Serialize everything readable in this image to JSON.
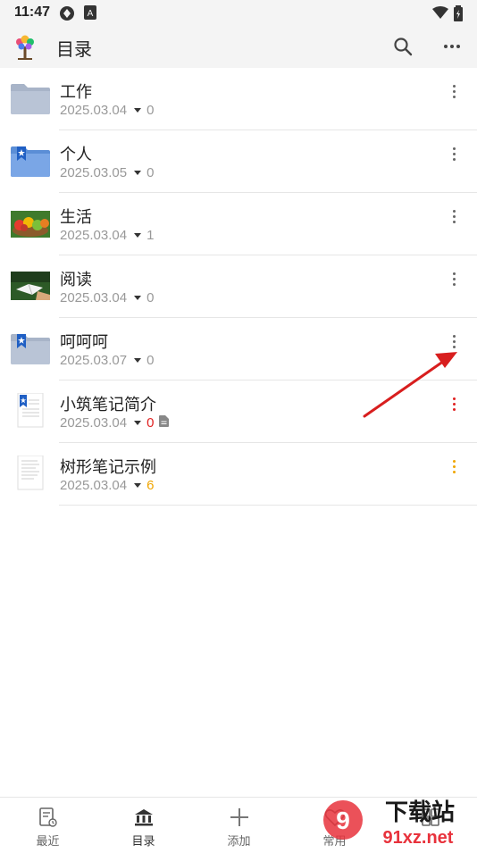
{
  "status": {
    "time": "11:47"
  },
  "header": {
    "title": "目录"
  },
  "items": [
    {
      "name": "工作",
      "date": "2025.03.04",
      "count": "0",
      "count_color": "#999999",
      "thumb": "folder-icon",
      "more_color": "#666666"
    },
    {
      "name": "个人",
      "date": "2025.03.05",
      "count": "0",
      "count_color": "#999999",
      "thumb": "bookmark-folder-icon",
      "more_color": "#666666"
    },
    {
      "name": "生活",
      "date": "2025.03.04",
      "count": "1",
      "count_color": "#999999",
      "thumb": "fruit-photo",
      "more_color": "#666666"
    },
    {
      "name": "阅读",
      "date": "2025.03.04",
      "count": "0",
      "count_color": "#999999",
      "thumb": "reading-photo",
      "more_color": "#666666"
    },
    {
      "name": "呵呵呵",
      "date": "2025.03.07",
      "count": "0",
      "count_color": "#999999",
      "thumb": "bookmark-folder-icon",
      "more_color": "#666666"
    },
    {
      "name": "小筑笔记简介",
      "date": "2025.03.04",
      "count": "0",
      "count_color": "#e02020",
      "thumb": "bookmark-note-icon",
      "more_color": "#e02020",
      "has_doc_icon": true
    },
    {
      "name": "树形笔记示例",
      "date": "2025.03.04",
      "count": "6",
      "count_color": "#f0a500",
      "thumb": "note-icon",
      "more_color": "#f0a500"
    }
  ],
  "nav": [
    {
      "label": "最近",
      "icon": "recent-icon"
    },
    {
      "label": "目录",
      "icon": "catalog-icon",
      "active": true
    },
    {
      "label": "添加",
      "icon": "add-icon"
    },
    {
      "label": "常用",
      "icon": "favorites-icon"
    },
    {
      "label": "",
      "icon": "more-icon"
    }
  ],
  "watermark": {
    "text1": "下载站",
    "text2": "91xz.net"
  }
}
